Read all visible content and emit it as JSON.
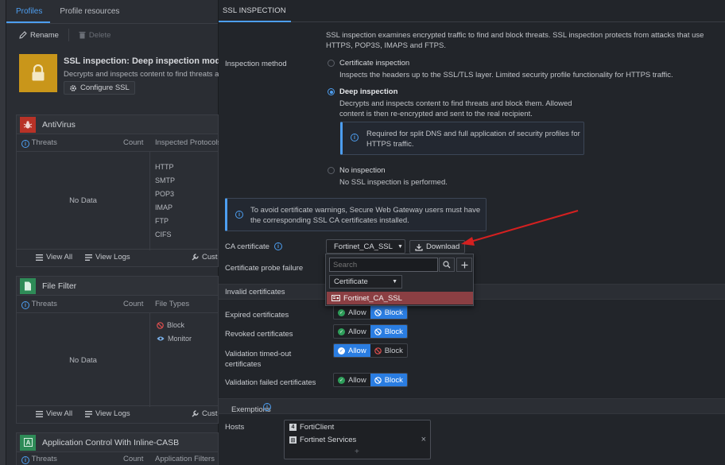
{
  "left": {
    "tabs": [
      "Profiles",
      "Profile resources"
    ],
    "toolbar": {
      "rename": "Rename",
      "delete": "Delete"
    },
    "profile": {
      "title": "SSL inspection: Deep inspection mode",
      "desc": "Decrypts and inspects content to find threats a",
      "configure": "Configure SSL",
      "icon": "lock-icon",
      "icon_color": "#c9961a"
    },
    "antivirus": {
      "title": "AntiVirus",
      "col_threats": "Threats",
      "col_count": "Count",
      "col_protocols": "Inspected Protocols",
      "no_data": "No Data",
      "protocols": [
        "HTTP",
        "SMTP",
        "POP3",
        "IMAP",
        "FTP",
        "CIFS"
      ],
      "view_all": "View All",
      "view_logs": "View Logs",
      "custom": "Cust",
      "icon_color": "#c0392b"
    },
    "filefilter": {
      "title": "File Filter",
      "col_threats": "Threats",
      "col_count": "Count",
      "col_types": "File Types",
      "no_data": "No Data",
      "block": "Block",
      "monitor": "Monitor",
      "view_all": "View All",
      "view_logs": "View Logs",
      "custom": "Cust",
      "icon_color": "#2e8b57"
    },
    "appcontrol": {
      "title": "Application Control With Inline-CASB",
      "col_threats": "Threats",
      "col_count": "Count",
      "col_filters": "Application Filters",
      "icon_color": "#2e8b57"
    }
  },
  "right": {
    "tab": "SSL INSPECTION",
    "intro": "SSL inspection examines encrypted traffic to find and block threats. SSL inspection protects from attacks that use HTTPS, POP3S, IMAPS and FTPS.",
    "inspection_method_label": "Inspection method",
    "options": [
      {
        "title": "Certificate inspection",
        "desc": "Inspects the headers up to the SSL/TLS layer. Limited security profile functionality for HTTPS traffic.",
        "selected": false
      },
      {
        "title": "Deep inspection",
        "desc": "Decrypts and inspects content to find threats and block them. Allowed content is then re-encrypted and sent to the real recipient.",
        "selected": true
      },
      {
        "title": "No inspection",
        "desc": "No SSL inspection is performed.",
        "selected": false
      }
    ],
    "deep_note": "Required for split DNS and full application of security profiles for HTTPS traffic.",
    "warning": "To avoid certificate warnings, Secure Web Gateway users must have the corresponding SSL CA certificates installed.",
    "ca_label": "CA certificate",
    "ca_value": "Fortinet_CA_SSL",
    "download": "Download",
    "probe_label": "Certificate probe failure",
    "dropdown": {
      "search_placeholder": "Search",
      "category": "Certificate",
      "item": "Fortinet_CA_SSL"
    },
    "invalid_header": "Invalid certificates",
    "cert_rows": [
      {
        "label": "Expired certificates",
        "allow": "Allow",
        "block": "Block",
        "selected": "block"
      },
      {
        "label": "Revoked certificates",
        "allow": "Allow",
        "block": "Block",
        "selected": "block"
      },
      {
        "label": "Validation timed-out certificates",
        "allow": "Allow",
        "block": "Block",
        "selected": "allow"
      },
      {
        "label": "Validation failed certificates",
        "allow": "Allow",
        "block": "Block",
        "selected": "block"
      }
    ],
    "exemptions_header": "Exemptions",
    "hosts_label": "Hosts",
    "hosts": [
      "FortiClient",
      "Fortinet Services"
    ],
    "accent": "#2a7de1",
    "arrow_color": "#d42020"
  }
}
